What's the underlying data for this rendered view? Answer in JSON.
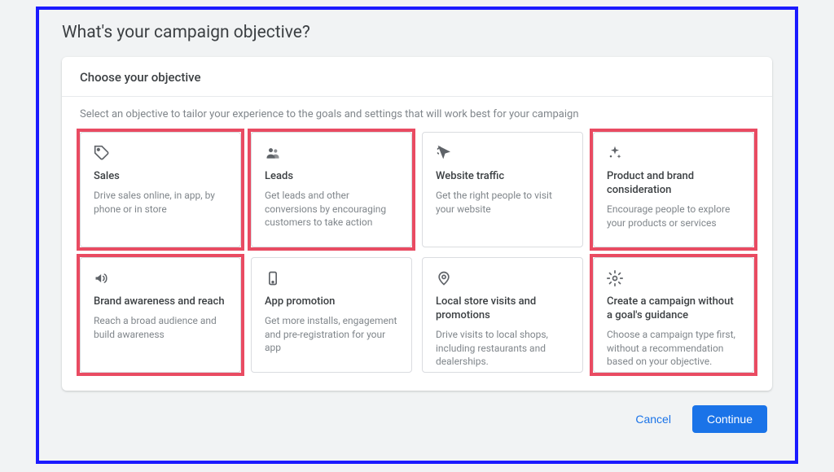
{
  "pageTitle": "What's your campaign objective?",
  "cardHeader": "Choose your objective",
  "cardSubtitle": "Select an objective to tailor your experience to the goals and settings that will work best for your campaign",
  "objectives": [
    {
      "icon": "tag",
      "title": "Sales",
      "desc": "Drive sales online, in app, by phone or in store",
      "highlighted": true
    },
    {
      "icon": "people",
      "title": "Leads",
      "desc": "Get leads and other conversions by encouraging customers to take action",
      "highlighted": true
    },
    {
      "icon": "cursor",
      "title": "Website traffic",
      "desc": "Get the right people to visit your website",
      "highlighted": false
    },
    {
      "icon": "sparkle",
      "title": "Product and brand consideration",
      "desc": "Encourage people to explore your products or services",
      "highlighted": true
    },
    {
      "icon": "megaphone",
      "title": "Brand awareness and reach",
      "desc": "Reach a broad audience and build awareness",
      "highlighted": true
    },
    {
      "icon": "phone",
      "title": "App promotion",
      "desc": "Get more installs, engagement and pre-registration for your app",
      "highlighted": false
    },
    {
      "icon": "pin",
      "title": "Local store visits and promotions",
      "desc": "Drive visits to local shops, including restaurants and dealerships.",
      "highlighted": false
    },
    {
      "icon": "gear",
      "title": "Create a campaign without a goal's guidance",
      "desc": "Choose a campaign type first, without a recommendation based on your objective.",
      "highlighted": true
    }
  ],
  "footer": {
    "cancel": "Cancel",
    "continue": "Continue"
  }
}
